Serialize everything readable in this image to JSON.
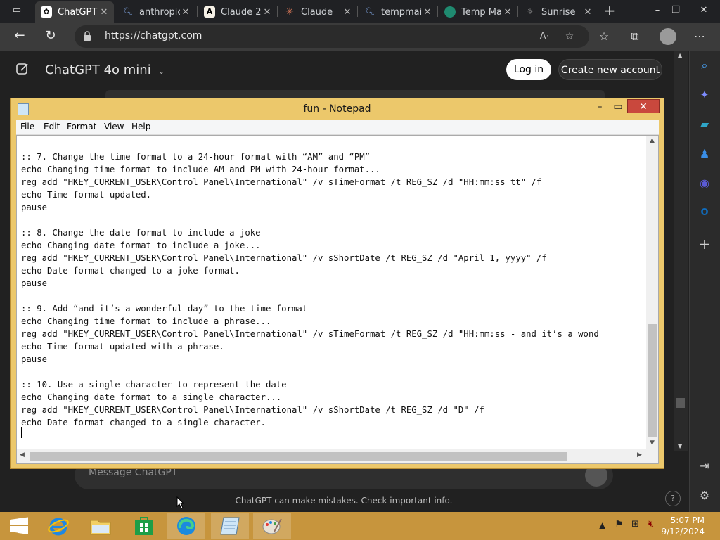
{
  "browser": {
    "tabs": [
      {
        "title": "ChatGPT",
        "favicon": "openai-icon",
        "active": true
      },
      {
        "title": "anthropic",
        "favicon": "search-icon",
        "active": false
      },
      {
        "title": "Claude 2",
        "favicon": "anthropic-icon",
        "active": false
      },
      {
        "title": "Claude",
        "favicon": "claude-icon",
        "active": false
      },
      {
        "title": "tempmail",
        "favicon": "search-icon",
        "active": false
      },
      {
        "title": "Temp Mail",
        "favicon": "tempmail-icon",
        "active": false
      },
      {
        "title": "Sunrise",
        "favicon": "sunrise-icon",
        "active": false
      }
    ],
    "url": "https://chatgpt.com"
  },
  "chatgpt": {
    "model_title": "ChatGPT 4o mini",
    "login_label": "Log in",
    "signup_label": "Create new account",
    "message_placeholder": "Message ChatGPT",
    "disclaimer": "ChatGPT can make mistakes. Check important info.",
    "help_label": "?"
  },
  "notepad": {
    "title": "fun - Notepad",
    "menu": [
      "File",
      "Edit",
      "Format",
      "View",
      "Help"
    ],
    "lines": [
      ":: 7. Change the time format to a 24-hour format with “AM” and “PM”",
      "echo Changing time format to include AM and PM with 24-hour format...",
      "reg add \"HKEY_CURRENT_USER\\Control Panel\\International\" /v sTimeFormat /t REG_SZ /d \"HH:mm:ss tt\" /f",
      "echo Time format updated.",
      "pause",
      "",
      ":: 8. Change the date format to include a joke",
      "echo Changing date format to include a joke...",
      "reg add \"HKEY_CURRENT_USER\\Control Panel\\International\" /v sShortDate /t REG_SZ /d \"April 1, yyyy\" /f",
      "echo Date format changed to a joke format.",
      "pause",
      "",
      ":: 9. Add “and it’s a wonderful day” to the time format",
      "echo Changing time format to include a phrase...",
      "reg add \"HKEY_CURRENT_USER\\Control Panel\\International\" /v sTimeFormat /t REG_SZ /d \"HH:mm:ss - and it’s a wond",
      "echo Time format updated with a phrase.",
      "pause",
      "",
      ":: 10. Use a single character to represent the date",
      "echo Changing date format to a single character...",
      "reg add \"HKEY_CURRENT_USER\\Control Panel\\International\" /v sShortDate /t REG_SZ /d \"D\" /f",
      "echo Date format changed to a single character."
    ]
  },
  "taskbar": {
    "items": [
      {
        "name": "start-button",
        "icon": "windows-logo-icon"
      },
      {
        "name": "internet-explorer",
        "icon": "ie-icon"
      },
      {
        "name": "file-explorer",
        "icon": "folder-icon"
      },
      {
        "name": "store",
        "icon": "store-icon"
      },
      {
        "name": "edge",
        "icon": "edge-icon"
      },
      {
        "name": "notepad",
        "icon": "notepad-icon"
      },
      {
        "name": "paint",
        "icon": "paint-icon"
      }
    ],
    "time": "5:07 PM",
    "date": "9/12/2024"
  },
  "colors": {
    "taskbar": "#c7953d",
    "notepad_frame": "#ecc86b",
    "close_button": "#c9483d",
    "page_background": "#212121"
  }
}
